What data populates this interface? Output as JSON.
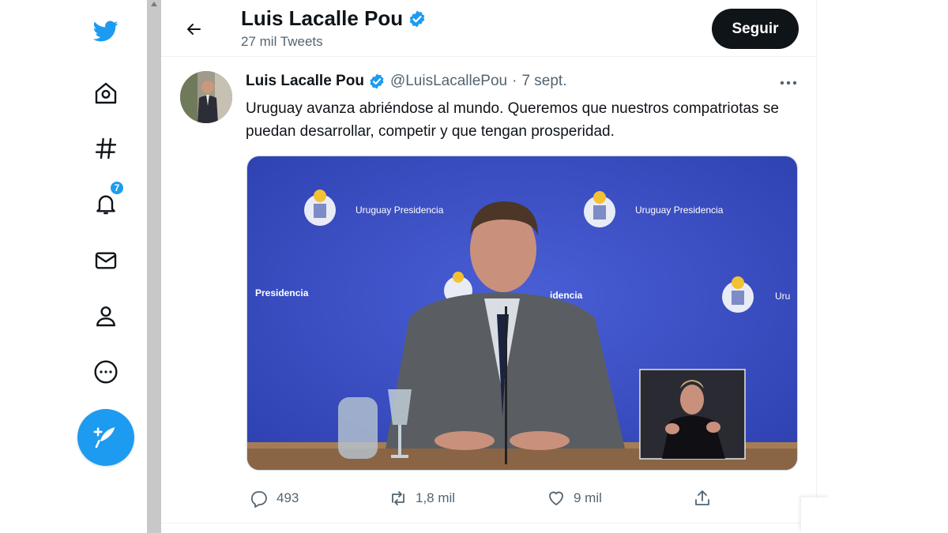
{
  "nav": {
    "items": [
      {
        "name": "twitter-logo-icon"
      },
      {
        "name": "home-icon"
      },
      {
        "name": "explore-hashtag-icon"
      },
      {
        "name": "notifications-bell-icon"
      },
      {
        "name": "messages-mail-icon"
      },
      {
        "name": "profile-person-icon"
      },
      {
        "name": "more-circle-icon"
      }
    ],
    "notifications_badge": "7",
    "compose_icon": "feather-plus-icon"
  },
  "header": {
    "name": "Luis Lacalle Pou",
    "tweet_count": "27 mil Tweets",
    "follow_label": "Seguir",
    "verified": true
  },
  "tweet": {
    "name": "Luis Lacalle Pou",
    "handle": "@LuisLacallePou",
    "separator": "·",
    "date": "7 sept.",
    "text": "Uruguay avanza abriéndose al mundo. Queremos que nuestros compatriotas se puedan desarrollar, competir y que tengan prosperidad.",
    "media": {
      "backdrop_texts": [
        "Uruguay Presidencia",
        "Uruguay Presidencia",
        "Presidencia",
        "idencia",
        "Uru"
      ],
      "backdrop_color": "#3d52c4"
    },
    "actions": {
      "replies": "493",
      "retweets": "1,8 mil",
      "likes": "9 mil"
    }
  },
  "colors": {
    "accent": "#1d9bf0",
    "text": "#0f1419",
    "muted": "#536471"
  }
}
